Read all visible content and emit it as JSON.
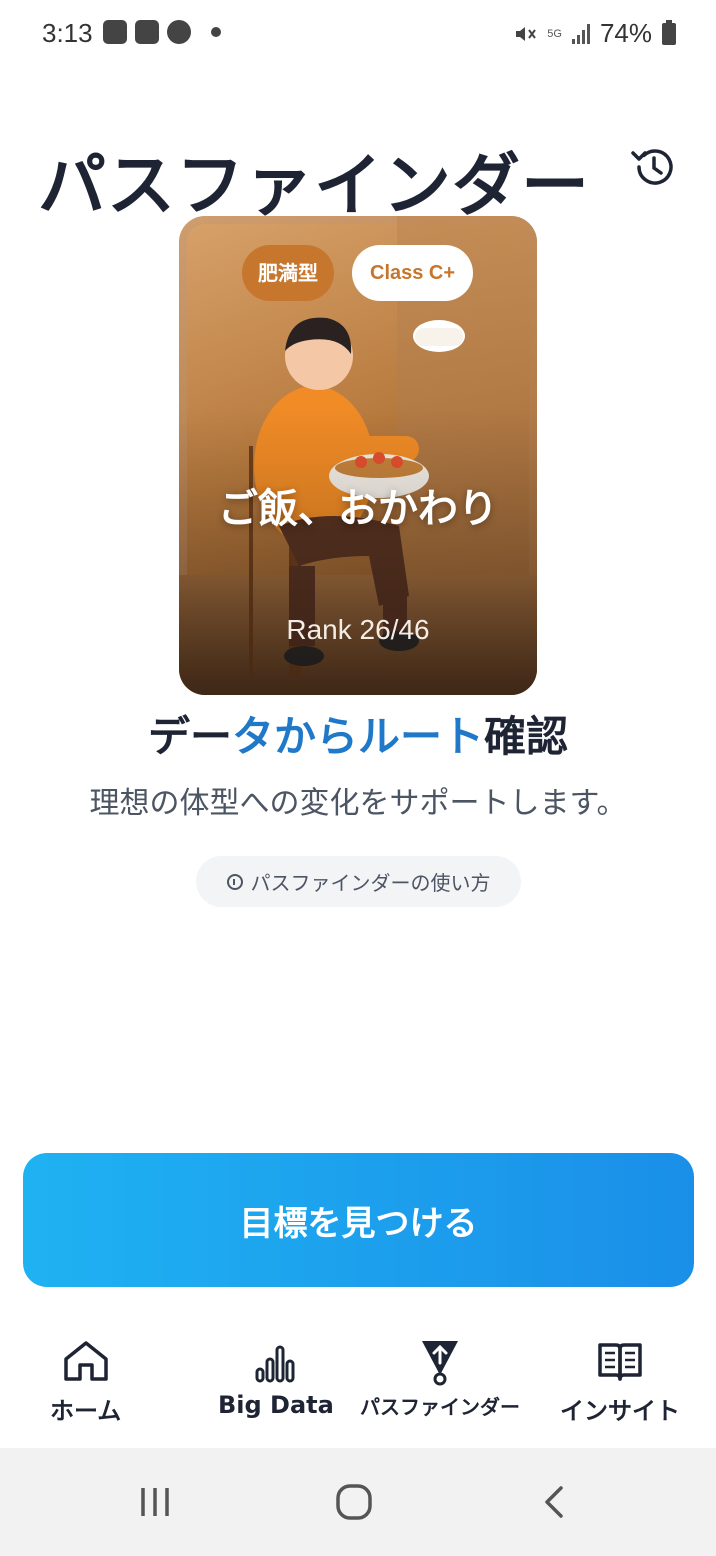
{
  "status_bar": {
    "time": "3:13",
    "network": "5G",
    "battery": "74%"
  },
  "header": {
    "title": "パスファインダー",
    "history_icon": "history-icon"
  },
  "card": {
    "type_badge": "肥満型",
    "class_badge": "Class C+",
    "name": "ご飯、おかわり",
    "rank": "Rank 26/46"
  },
  "headline": {
    "part1": "デー",
    "part2": "タからルート",
    "part3": "確認"
  },
  "subtitle": "理想の体型への変化をサポートします。",
  "howto_link": "パスファインダーの使い方",
  "cta_label": "目標を見つける",
  "nav": {
    "items": [
      {
        "label": "ホーム",
        "icon": "home-icon"
      },
      {
        "label": "Big Data",
        "icon": "bar-chart-icon"
      },
      {
        "label": "パスファインダー",
        "icon": "pathfinder-icon"
      },
      {
        "label": "インサイト",
        "icon": "book-icon"
      }
    ]
  },
  "colors": {
    "accent_blue": "#1f78c8",
    "cta_start": "#1fb2f2",
    "cta_end": "#1a8fe8",
    "badge_orange": "#c7762e",
    "text_dark": "#1e2433"
  }
}
